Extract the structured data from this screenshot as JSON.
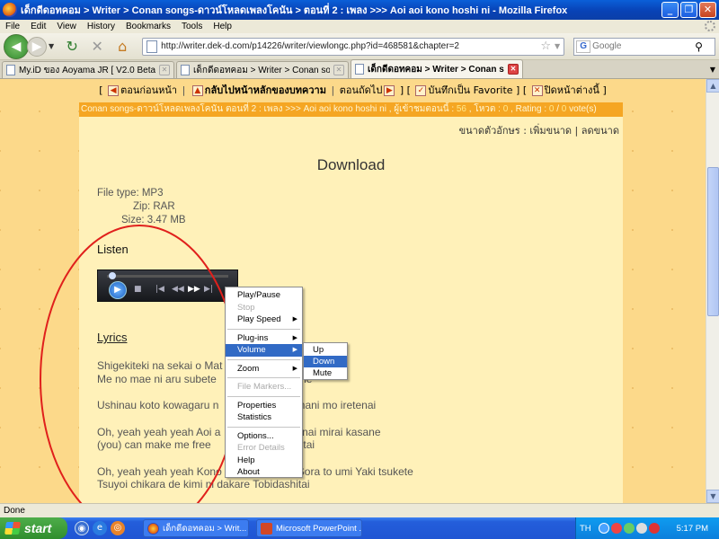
{
  "window": {
    "title": "เด็กดีดอทคอม > Writer > Conan songs-ดาวน์โหลดเพลงโคนัน > ตอนที่ 2 : เพลง >>> Aoi aoi kono hoshi ni - Mozilla Firefox",
    "buttons": [
      "_",
      "❐",
      "✕"
    ]
  },
  "menubar": [
    "File",
    "Edit",
    "View",
    "History",
    "Bookmarks",
    "Tools",
    "Help"
  ],
  "navbar": {
    "url": "http://writer.dek-d.com/p14226/writer/viewlongc.php?id=468581&chapter=2",
    "search_placeholder": "Google"
  },
  "tabs": [
    {
      "label": "My.iD ของ Aoyama JR [ V2.0 Beta ]",
      "active": false
    },
    {
      "label": "เด็กดีดอทคอม > Writer > Conan songs...",
      "active": false
    },
    {
      "label": "เด็กดีดอทคอม > Writer > Conan s...",
      "active": true
    }
  ],
  "page": {
    "topnav": {
      "prev": "ตอนก่อนหน้า",
      "main": "กลับไปหน้าหลักของบทความ",
      "next": "ตอนถัดไป",
      "favorite": "บันทึกเป็น Favorite",
      "close": "ปิดหน้าต่างนี้"
    },
    "infobar": {
      "text_prefix": "Conan songs-ดาวน์โหลดเพลงโคนัน ตอนที่ 2 : เพลง >>> Aoi aoi kono hoshi ni , ผู้เข้าชมตอนนี้ : ",
      "views": "56",
      "vote_label": " , โหวต : ",
      "votes": "0",
      "rating_label": " , Rating : ",
      "rating": "0",
      "rating_sep": " / ",
      "rating_count": "0",
      "rating_suffix": " vote(s)"
    },
    "fontsize": {
      "label": "ขนาดตัวอักษร : ",
      "increase": "เพิ่มขนาด",
      "sep": " | ",
      "decrease": "ลดขนาด"
    },
    "download_heading": "Download",
    "fileinfo": {
      "type": "File type: MP3",
      "zip": "Zip: RAR",
      "size": "Size: 3.47 MB"
    },
    "listen_heading": "Listen",
    "lyrics_heading": "Lyrics",
    "lyrics": [
      [
        "Shigekiteki na sekai o Mat",
        "Me no mae ni aru subete                  mada ne"
      ],
      [
        "Ushinau koto kowagaru n               i mada nani mo iretenai"
      ],
      [
        "Oh, yeah yeah yeah Aoi a                  Kagirinai mirai kasane",
        "(you) can make me free               u Kanjite itai"
      ],
      [
        "Oh, yeah yeah yeah Kono                   are Sora to umi Yaki tsukete",
        "Tsuyoi chikara de kimi ni dakare Tobidashitai"
      ]
    ]
  },
  "context_menu": {
    "items": [
      {
        "label": "Play/Pause",
        "disabled": false,
        "submenu": false
      },
      {
        "label": "Stop",
        "disabled": true,
        "submenu": false
      },
      {
        "label": "Play Speed",
        "disabled": false,
        "submenu": true
      },
      {
        "sep": true
      },
      {
        "label": "Plug-ins",
        "disabled": false,
        "submenu": true
      },
      {
        "label": "Volume",
        "disabled": false,
        "submenu": true,
        "selected": true
      },
      {
        "sep": true
      },
      {
        "label": "Zoom",
        "disabled": false,
        "submenu": true
      },
      {
        "sep": true
      },
      {
        "label": "File Markers...",
        "disabled": true,
        "submenu": false
      },
      {
        "sep": true
      },
      {
        "label": "Properties",
        "disabled": false,
        "submenu": false
      },
      {
        "label": "Statistics",
        "disabled": false,
        "submenu": false
      },
      {
        "sep": true
      },
      {
        "label": "Options...",
        "disabled": false,
        "submenu": false
      },
      {
        "label": "Error Details",
        "disabled": true,
        "submenu": false
      },
      {
        "label": "Help",
        "disabled": false,
        "submenu": false
      },
      {
        "label": "About",
        "disabled": false,
        "submenu": false
      }
    ],
    "volume_submenu": [
      {
        "label": "Up",
        "selected": false
      },
      {
        "label": "Down",
        "selected": true
      },
      {
        "label": "Mute",
        "selected": false
      }
    ]
  },
  "status": "Done",
  "taskbar": {
    "start": "start",
    "items": [
      {
        "label": "เด็กดีดอทคอม > Writ...",
        "icon": "firefox-icon"
      },
      {
        "label": "Microsoft PowerPoint ...",
        "icon": "powerpoint-icon"
      }
    ],
    "lang": "TH",
    "clock": "5:17 PM"
  },
  "colors": {
    "page_bg": "#fcd98a",
    "panel_bg": "#fff1b9",
    "infobar_bg": "#f5a623",
    "annotation": "#e0201c",
    "menu_highlight": "#316ac5"
  }
}
